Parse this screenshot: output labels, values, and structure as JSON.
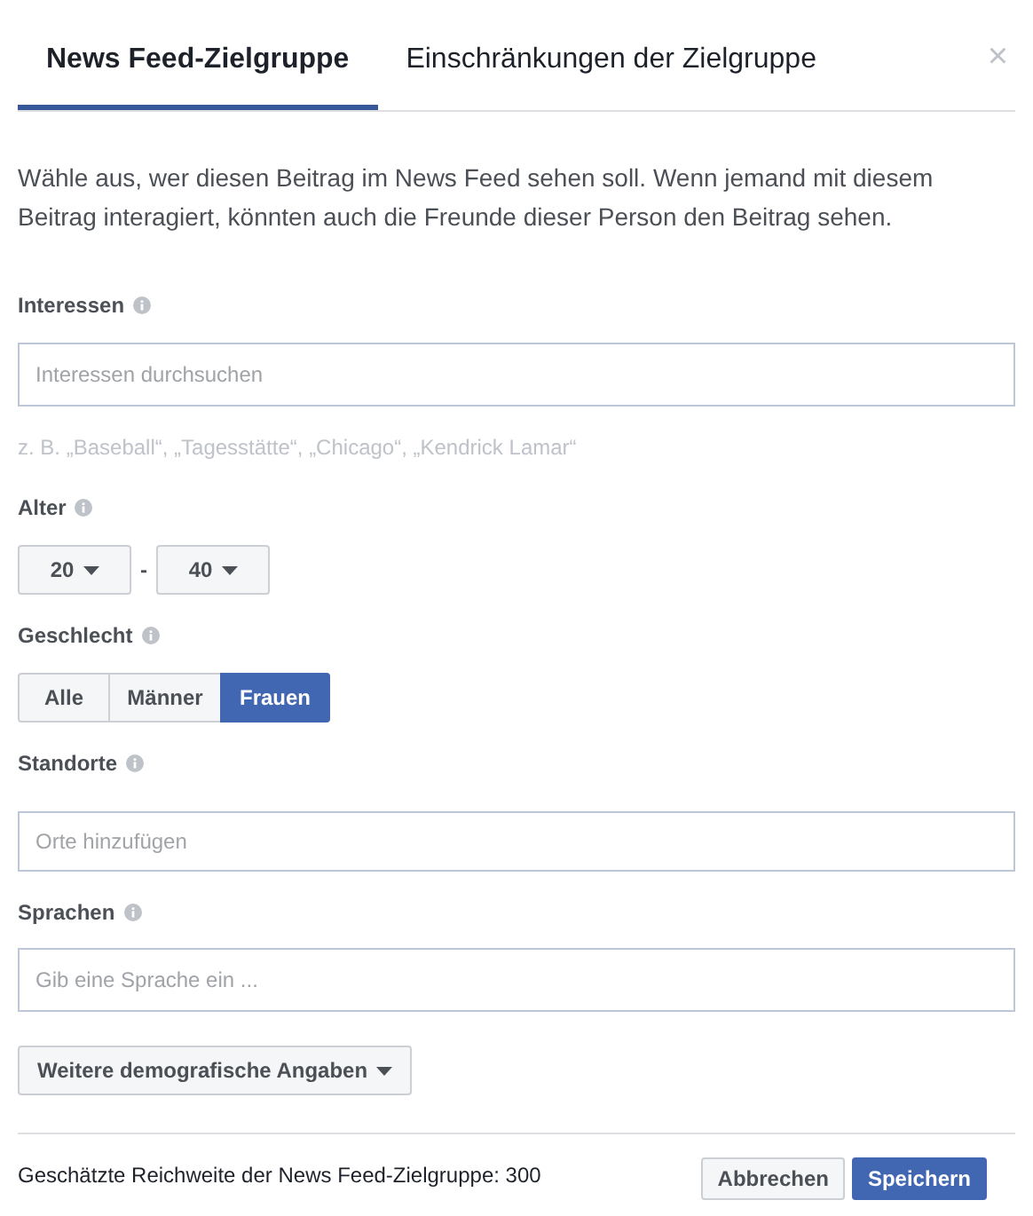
{
  "tabs": [
    {
      "label": "News Feed-Zielgruppe",
      "selected": true
    },
    {
      "label": "Einschränkungen der Zielgruppe",
      "selected": false
    }
  ],
  "close": "×",
  "description": "Wähle aus, wer diesen Beitrag im News Feed sehen soll. Wenn jemand mit diesem Beitrag interagiert, könnten auch die Freunde dieser Person den Beitrag sehen.",
  "interests": {
    "label": "Interessen",
    "placeholder": "Interessen durchsuchen",
    "hint": "z. B. „Baseball“, „Tagesstätte“, „Chicago“, „Kendrick Lamar“"
  },
  "age": {
    "label": "Alter",
    "from": "20",
    "separator": "-",
    "to": "40"
  },
  "gender": {
    "label": "Geschlecht",
    "options": [
      {
        "label": "Alle",
        "selected": false
      },
      {
        "label": "Männer",
        "selected": false
      },
      {
        "label": "Frauen",
        "selected": true
      }
    ]
  },
  "locations": {
    "label": "Standorte",
    "placeholder": "Orte hinzufügen"
  },
  "languages": {
    "label": "Sprachen",
    "placeholder": "Gib eine Sprache ein ..."
  },
  "more_button": "Weitere demografische Angaben",
  "footer": {
    "reach": "Geschätzte Reichweite der News Feed-Zielgruppe: 300",
    "buttons": [
      {
        "label": "Abbrechen",
        "kind": "secondary"
      },
      {
        "label": "Speichern",
        "kind": "primary"
      }
    ]
  }
}
